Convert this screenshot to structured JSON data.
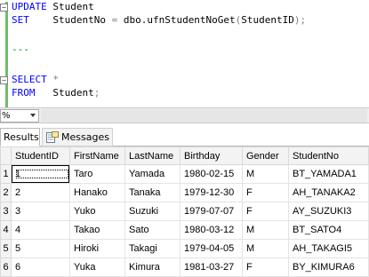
{
  "editor": {
    "lines": [
      {
        "kw": "UPDATE",
        "rest": " Student"
      },
      {
        "kw": "SET",
        "rest1": "    StudentNo ",
        "op": "=",
        "rest2": " dbo.ufnStudentNoGet",
        "paren_open": "(",
        "arg": "StudentID",
        "paren_close": ")",
        "semi": ";"
      },
      {
        "blank": ""
      },
      {
        "comment": "---"
      },
      {
        "blank": ""
      },
      {
        "kw": "SELECT",
        "rest": " *"
      },
      {
        "kw": "FROM",
        "rest": "   Student",
        "semi": ";"
      }
    ]
  },
  "zoom": {
    "value": "%"
  },
  "tabs": [
    {
      "label": "Results"
    },
    {
      "label": "Messages"
    }
  ],
  "grid": {
    "columns": [
      "StudentID",
      "FirstName",
      "LastName",
      "Birthday",
      "Gender",
      "StudentNo"
    ],
    "rows": [
      {
        "num": "1",
        "cells": [
          "1",
          "Taro",
          "Yamada",
          "1980-02-15",
          "M",
          "BT_YAMADA1"
        ]
      },
      {
        "num": "2",
        "cells": [
          "2",
          "Hanako",
          "Tanaka",
          "1979-12-30",
          "F",
          "AH_TANAKA2"
        ]
      },
      {
        "num": "3",
        "cells": [
          "3",
          "Yuko",
          "Suzuki",
          "1979-07-07",
          "F",
          "AY_SUZUKI3"
        ]
      },
      {
        "num": "4",
        "cells": [
          "4",
          "Takao",
          "Sato",
          "1980-03-12",
          "M",
          "BT_SATO4"
        ]
      },
      {
        "num": "5",
        "cells": [
          "5",
          "Hiroki",
          "Takagi",
          "1979-04-05",
          "M",
          "AH_TAKAGI5"
        ]
      },
      {
        "num": "6",
        "cells": [
          "6",
          "Yuka",
          "Kimura",
          "1981-03-27",
          "F",
          "BY_KIMURA6"
        ]
      }
    ]
  },
  "colors": {
    "keyword": "#0000ff",
    "function_name": "#ff00ff",
    "comment": "#008000",
    "operator": "#808080",
    "change_marker": "#6fbd6b"
  }
}
